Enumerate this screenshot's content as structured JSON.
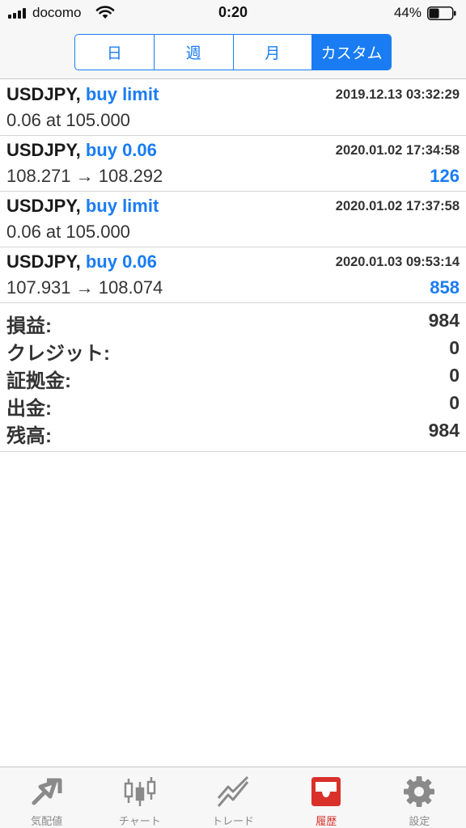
{
  "status_bar": {
    "carrier": "docomo",
    "time": "0:20",
    "battery_percent": "44%",
    "battery_level": 0.44
  },
  "period_tabs": {
    "items": [
      "日",
      "週",
      "月",
      "カスタム"
    ],
    "selected": "カスタム"
  },
  "trades": [
    {
      "symbol": "USDJPY,",
      "side": "buy limit",
      "time": "2019.12.13 03:32:29",
      "detail": "0.06 at 105.000",
      "profit": ""
    },
    {
      "symbol": "USDJPY,",
      "side": "buy 0.06",
      "time": "2020.01.02 17:34:58",
      "detail": "108.271 → 108.292",
      "profit": "126"
    },
    {
      "symbol": "USDJPY,",
      "side": "buy limit",
      "time": "2020.01.02 17:37:58",
      "detail": "0.06 at 105.000",
      "profit": ""
    },
    {
      "symbol": "USDJPY,",
      "side": "buy 0.06",
      "time": "2020.01.03 09:53:14",
      "detail": "107.931 → 108.074",
      "profit": "858"
    }
  ],
  "summary": [
    {
      "label": "損益:",
      "value": "984"
    },
    {
      "label": "クレジット:",
      "value": "0"
    },
    {
      "label": "証拠金:",
      "value": "0"
    },
    {
      "label": "出金:",
      "value": "0"
    },
    {
      "label": "残高:",
      "value": "984"
    }
  ],
  "tab_bar": {
    "items": [
      {
        "label": "気配値",
        "icon": "quotes-arrows-icon"
      },
      {
        "label": "チャート",
        "icon": "chart-candles-icon"
      },
      {
        "label": "トレード",
        "icon": "trade-lines-icon"
      },
      {
        "label": "履歴",
        "icon": "history-tray-icon"
      },
      {
        "label": "設定",
        "icon": "settings-gear-icon"
      }
    ],
    "active": "履歴"
  },
  "colors": {
    "accent": "#1a7cf3",
    "active_tab": "#d9302a",
    "inactive_tab": "#8a8a8a"
  }
}
